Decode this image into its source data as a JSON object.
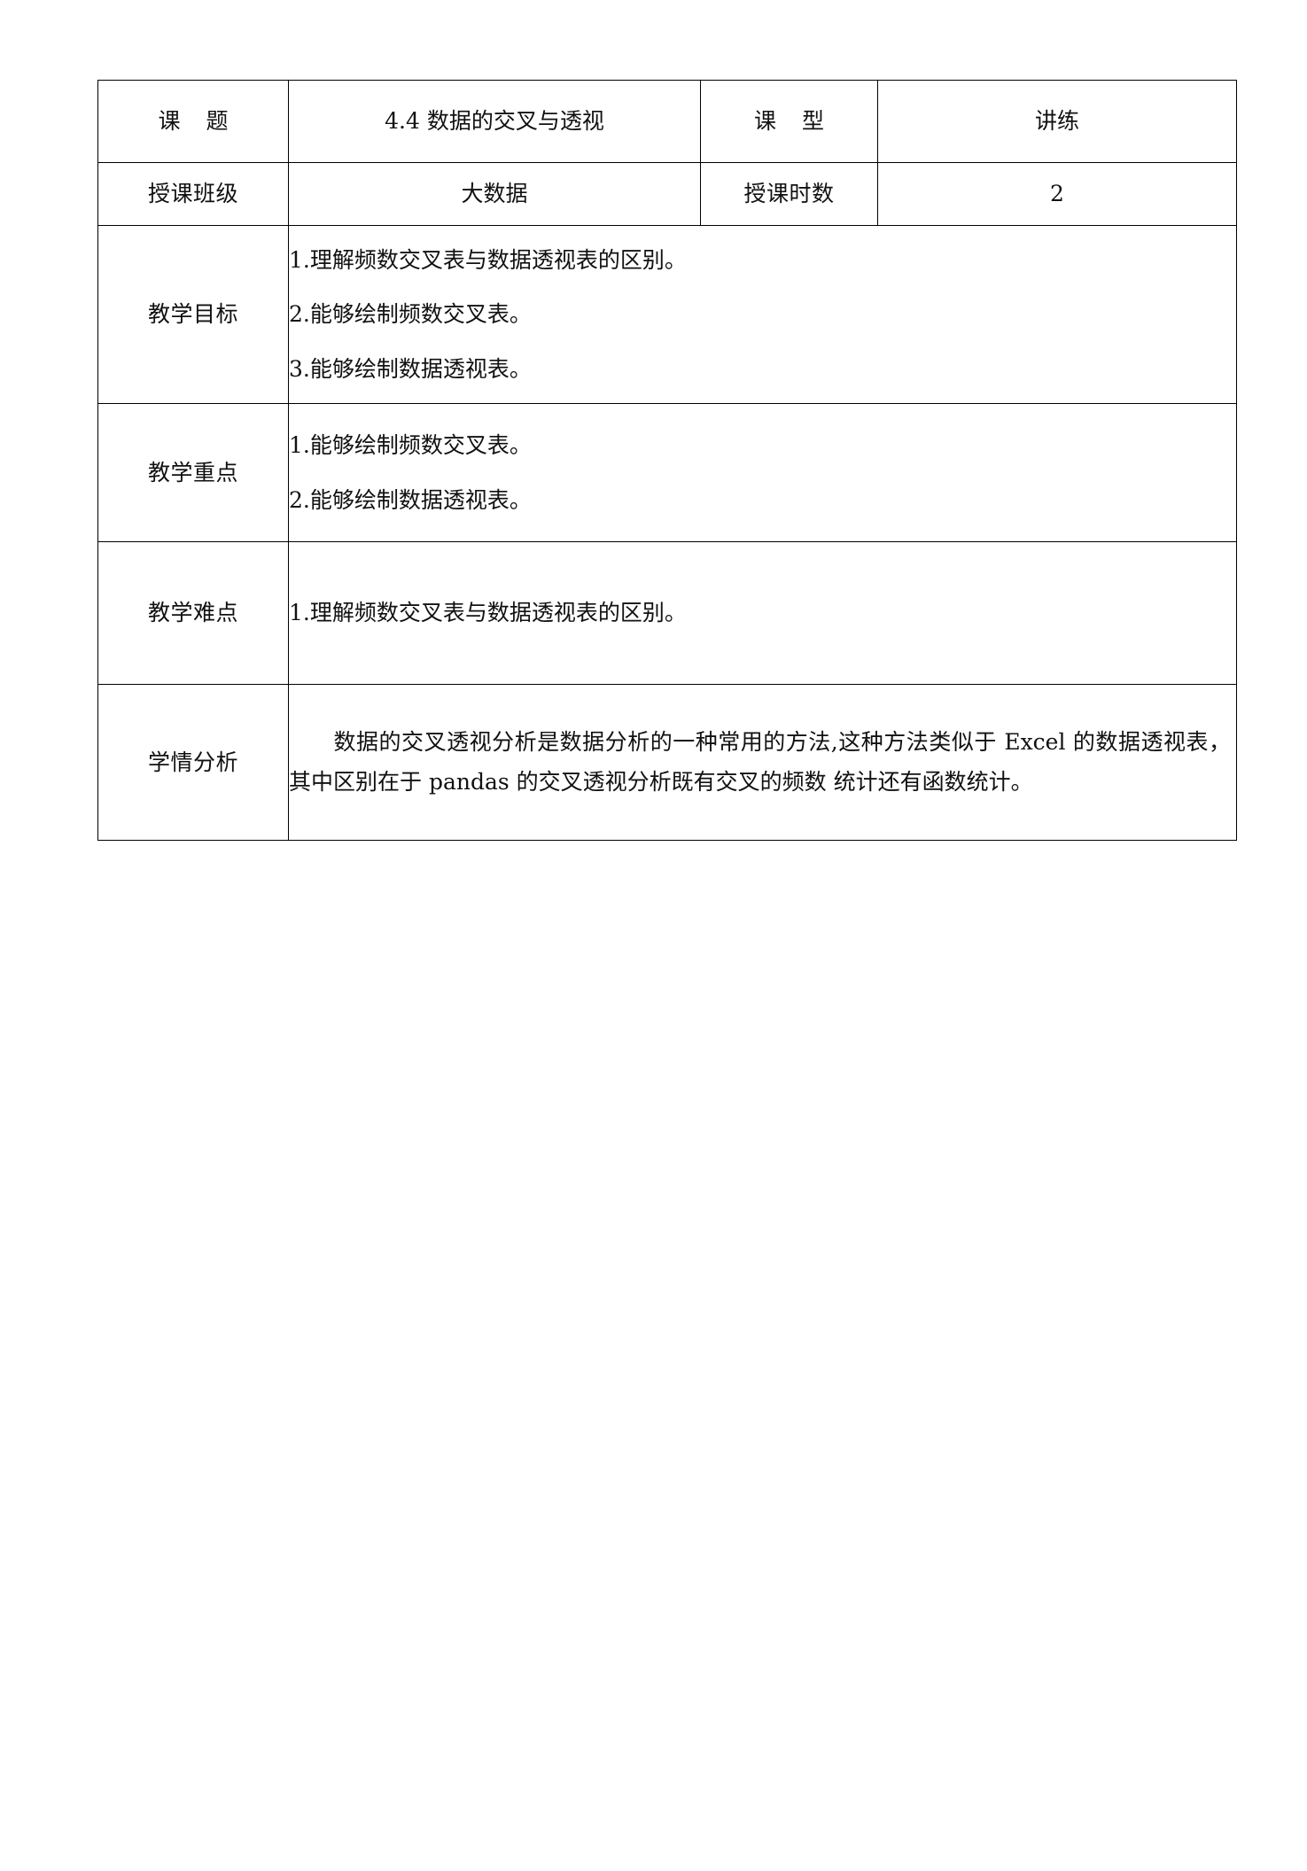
{
  "document": {
    "type": "lesson-plan-table",
    "rows": [
      {
        "label": "课 题",
        "value": "4.4 数据的交叉与透视",
        "label2": "课 型",
        "value2": "讲练"
      },
      {
        "label": "授课班级",
        "value": "大数据",
        "label2": "授课时数",
        "value2": "2"
      }
    ],
    "objectives": {
      "label": "教学目标",
      "items": [
        "1.理解频数交叉表与数据透视表的区别。",
        "2.能够绘制频数交叉表。",
        "3.能够绘制数据透视表。"
      ]
    },
    "key_points": {
      "label": "教学重点",
      "items": [
        "1.能够绘制频数交叉表。",
        "2.能够绘制数据透视表。"
      ]
    },
    "difficulties": {
      "label": "教学难点",
      "items": [
        "1.理解频数交叉表与数据透视表的区别。"
      ]
    },
    "analysis": {
      "label": "学情分析",
      "text": "数据的交叉透视分析是数据分析的一种常用的方法,这种方法类似于 Excel 的数据透视表，其中区别在于 pandas 的交叉透视分析既有交叉的频数 统计还有函数统计。"
    }
  }
}
